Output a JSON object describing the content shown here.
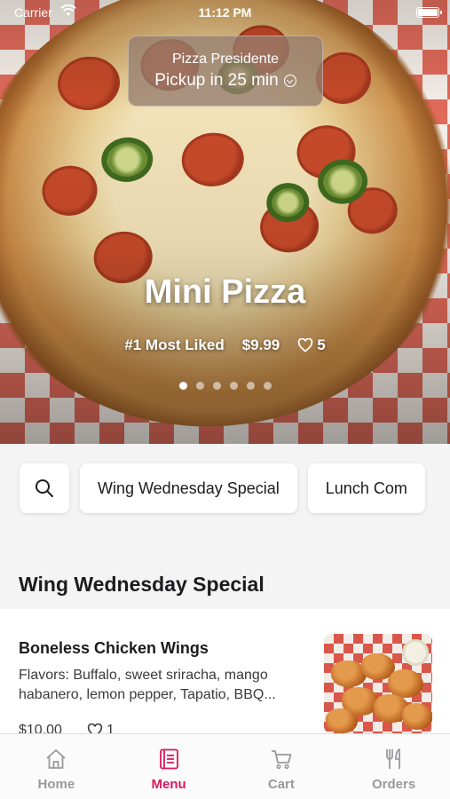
{
  "status_bar": {
    "carrier": "Carrier",
    "time": "11:12 PM"
  },
  "pickup": {
    "store": "Pizza Presidente",
    "eta": "Pickup in 25 min"
  },
  "hero": {
    "title": "Mini Pizza",
    "badge": "#1 Most Liked",
    "price": "$9.99",
    "likes": "5",
    "carousel_pages": 6,
    "carousel_active": 0
  },
  "categories": {
    "search_icon": "search-icon",
    "items": [
      "Wing Wednesday Special",
      "Lunch Com"
    ]
  },
  "section": {
    "title": "Wing Wednesday Special"
  },
  "menu_item": {
    "name": "Boneless Chicken Wings",
    "description": "Flavors: Buffalo, sweet sriracha, mango habanero, lemon pepper, Tapatio, BBQ...",
    "price": "$10.00",
    "likes": "1"
  },
  "tabs": [
    {
      "label": "Home",
      "icon": "home-icon",
      "active": false
    },
    {
      "label": "Menu",
      "icon": "menu-icon",
      "active": true
    },
    {
      "label": "Cart",
      "icon": "cart-icon",
      "active": false
    },
    {
      "label": "Orders",
      "icon": "orders-icon",
      "active": false
    }
  ],
  "colors": {
    "accent": "#d81b60",
    "inactive_tab": "#9a9a9e"
  }
}
